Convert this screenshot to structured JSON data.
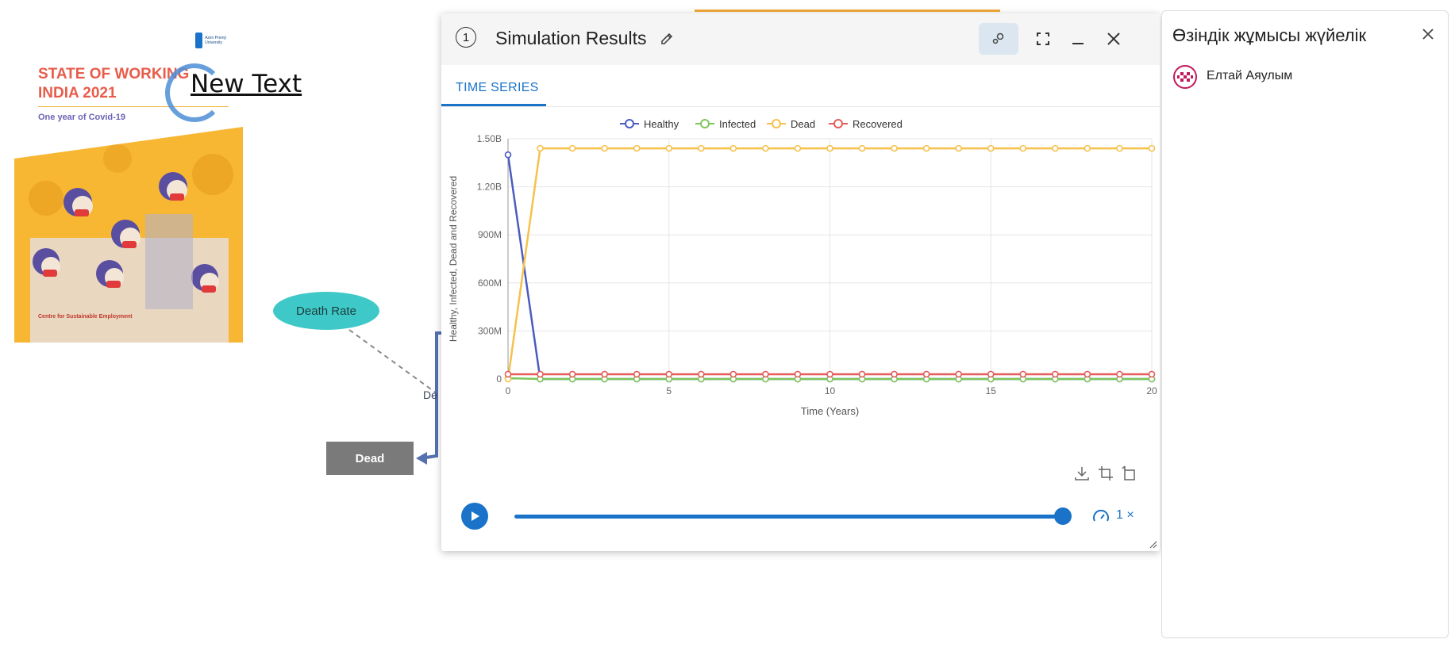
{
  "canvas": {
    "poster": {
      "logo_text": "Azim Premji University",
      "title": "STATE OF WORKING\nINDIA 2021",
      "subtitle": "One year of Covid-19",
      "footer": "Centre for Sustainable Employment"
    },
    "new_text": "New Text",
    "death_rate_label": "Death Rate",
    "dead_label": "Dead",
    "flow_label_partial": "De"
  },
  "dialog": {
    "number": "1",
    "title": "Simulation Results",
    "tabs": [
      {
        "label": "TIME SERIES",
        "active": true
      }
    ],
    "speed_label": "1 ×",
    "slider_progress": 1.0
  },
  "chart_data": {
    "type": "line",
    "xlabel": "Time (Years)",
    "ylabel": "Healthy, Infected, Dead and Recovered",
    "xlim": [
      0,
      20
    ],
    "ylim": [
      0,
      1500000000
    ],
    "x_ticks": [
      "0",
      "5",
      "10",
      "15",
      "20"
    ],
    "y_ticks": [
      "0",
      "300M",
      "600M",
      "900M",
      "1.20B",
      "1.50B"
    ],
    "legend_position": "top-center",
    "grid": true,
    "x": [
      0,
      1,
      2,
      3,
      4,
      5,
      6,
      7,
      8,
      9,
      10,
      11,
      12,
      13,
      14,
      15,
      16,
      17,
      18,
      19,
      20
    ],
    "series": [
      {
        "name": "Healthy",
        "color": "#4a5cc0",
        "values": [
          1400000000,
          0,
          0,
          0,
          0,
          0,
          0,
          0,
          0,
          0,
          0,
          0,
          0,
          0,
          0,
          0,
          0,
          0,
          0,
          0,
          0
        ]
      },
      {
        "name": "Infected",
        "color": "#7ec65a",
        "values": [
          5000000,
          0,
          0,
          0,
          0,
          0,
          0,
          0,
          0,
          0,
          0,
          0,
          0,
          0,
          0,
          0,
          0,
          0,
          0,
          0,
          0
        ]
      },
      {
        "name": "Dead",
        "color": "#f6c14c",
        "values": [
          0,
          1440000000,
          1440000000,
          1440000000,
          1440000000,
          1440000000,
          1440000000,
          1440000000,
          1440000000,
          1440000000,
          1440000000,
          1440000000,
          1440000000,
          1440000000,
          1440000000,
          1440000000,
          1440000000,
          1440000000,
          1440000000,
          1440000000,
          1440000000
        ]
      },
      {
        "name": "Recovered",
        "color": "#e65c5c",
        "values": [
          30000000,
          30000000,
          30000000,
          30000000,
          30000000,
          30000000,
          30000000,
          30000000,
          30000000,
          30000000,
          30000000,
          30000000,
          30000000,
          30000000,
          30000000,
          30000000,
          30000000,
          30000000,
          30000000,
          30000000,
          30000000
        ]
      }
    ]
  },
  "panel": {
    "title": "Өзіндік жұмысы жүйелік",
    "users": [
      {
        "name": "Елтай Аяулым"
      }
    ]
  },
  "icons": {
    "edit": "pencil-icon",
    "share": "share-icon",
    "fullscreen": "fullscreen-icon",
    "minimize": "minimize-icon",
    "close": "close-icon",
    "download": "download-icon",
    "crop": "crop-icon",
    "reset": "restore-icon",
    "play": "play-icon",
    "speed": "speedometer-icon"
  }
}
